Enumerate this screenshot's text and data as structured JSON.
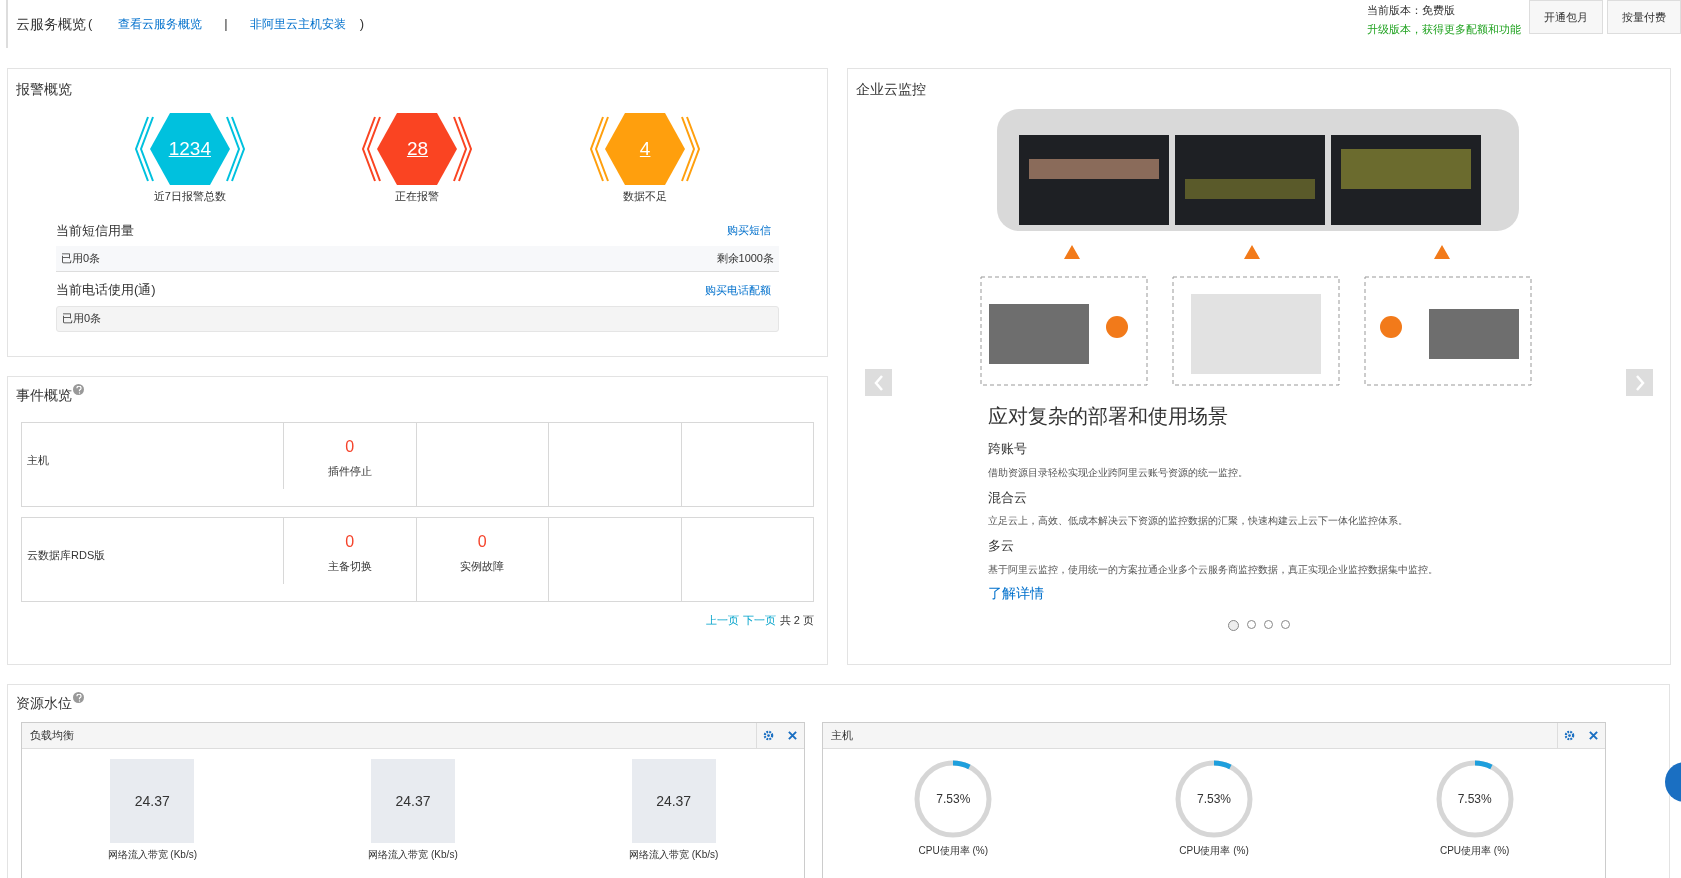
{
  "header": {
    "title": "云服务概览",
    "open_paren": "(",
    "links": [
      {
        "label": "查看云服务概览"
      },
      {
        "label": "非阿里云主机安装"
      }
    ],
    "separator": "|",
    "close_paren": ")",
    "version_label": "当前版本：免费版",
    "upgrade_text": "升级版本，获得更多配额和功能",
    "buttons": [
      "开通包月",
      "按量付费"
    ]
  },
  "alarms": {
    "title": "报警概览",
    "stats": [
      {
        "value": "1234",
        "label": "近7日报警总数",
        "color": "#00c1de"
      },
      {
        "value": "28",
        "label": "正在报警",
        "color": "#fa4422"
      },
      {
        "value": "4",
        "label": "数据不足",
        "color": "#ff9f0d"
      }
    ],
    "sms": {
      "title": "当前短信用量",
      "link": "购买短信",
      "used": "已用0条",
      "remaining": "剩余1000条"
    },
    "phone": {
      "title": "当前电话使用(通)",
      "link": "购买电话配额",
      "used": "已用0条"
    }
  },
  "events": {
    "title": "事件概览",
    "rows": [
      {
        "name": "主机",
        "cells": [
          {
            "value": "0",
            "label": "插件停止"
          }
        ]
      },
      {
        "name": "云数据库RDS版",
        "cells": [
          {
            "value": "0",
            "label": "主备切换"
          },
          {
            "value": "0",
            "label": "实例故障"
          }
        ]
      }
    ],
    "pagination": {
      "prev": "上一页",
      "next": "下一页",
      "total": "共 2 页"
    }
  },
  "enterprise": {
    "title": "企业云监控",
    "heading": "应对复杂的部署和使用场景",
    "sections": [
      {
        "title": "跨账号",
        "text": "借助资源目录轻松实现企业跨阿里云账号资源的统一监控。"
      },
      {
        "title": "混合云",
        "text": "立足云上，高效、低成本解决云下资源的监控数据的汇聚，快速构建云上云下一体化监控体系。"
      },
      {
        "title": "多云",
        "text": "基于阿里云监控，使用统一的方案拉通企业多个云服务商监控数据，真正实现企业监控数据集中监控。"
      }
    ],
    "link": "了解详情",
    "dots": [
      {
        "selected": true
      },
      {
        "selected": false
      },
      {
        "selected": false
      },
      {
        "selected": false
      }
    ]
  },
  "resources": {
    "title": "资源水位",
    "widgets": [
      {
        "title": "负载均衡",
        "kind": "tile",
        "items": [
          {
            "value": "24.37",
            "label": "网络流入带宽 (Kb/s)"
          },
          {
            "value": "24.37",
            "label": "网络流入带宽 (Kb/s)"
          },
          {
            "value": "24.37",
            "label": "网络流入带宽 (Kb/s)"
          }
        ]
      },
      {
        "title": "主机",
        "kind": "gauge",
        "items": [
          {
            "value": "7.53%",
            "label": "CPU使用率 (%)",
            "level": 0.0753
          },
          {
            "value": "7.53%",
            "label": "CPU使用率 (%)",
            "level": 0.0753
          },
          {
            "value": "7.53%",
            "label": "CPU使用率 (%)",
            "level": 0.0753
          }
        ]
      }
    ]
  }
}
